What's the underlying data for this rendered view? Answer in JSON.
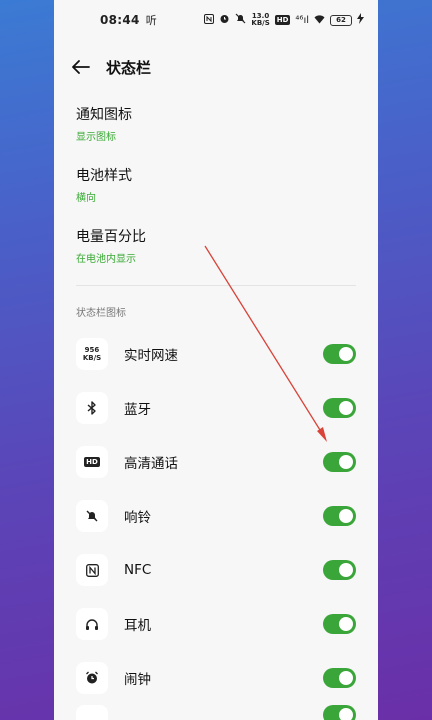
{
  "status_bar": {
    "time": "08:44",
    "left_icon": "听",
    "speed_top": "13.0",
    "speed_bottom": "KB/S",
    "hd": "HD",
    "signal": "⁴⁶ıl",
    "battery": "62"
  },
  "header": {
    "title": "状态栏"
  },
  "settings": [
    {
      "title": "通知图标",
      "sub": "显示图标"
    },
    {
      "title": "电池样式",
      "sub": "横向"
    },
    {
      "title": "电量百分比",
      "sub": "在电池内显示"
    }
  ],
  "section_label": "状态栏图标",
  "rows": [
    {
      "label": "实时网速",
      "icon": "speed-icon",
      "icon_top": "956",
      "icon_bottom": "KB/S",
      "enabled": true
    },
    {
      "label": "蓝牙",
      "icon": "bluetooth-icon",
      "enabled": true
    },
    {
      "label": "高清通话",
      "icon": "hd-icon",
      "icon_text": "HD",
      "enabled": true
    },
    {
      "label": "响铃",
      "icon": "bell-off-icon",
      "enabled": true
    },
    {
      "label": "NFC",
      "icon": "nfc-icon",
      "enabled": true
    },
    {
      "label": "耳机",
      "icon": "headphones-icon",
      "enabled": true
    },
    {
      "label": "闹钟",
      "icon": "alarm-icon",
      "enabled": true
    }
  ],
  "colors": {
    "accent": "#3aa639",
    "subtext": "#3aaa35",
    "annotation": "#d9443a"
  }
}
